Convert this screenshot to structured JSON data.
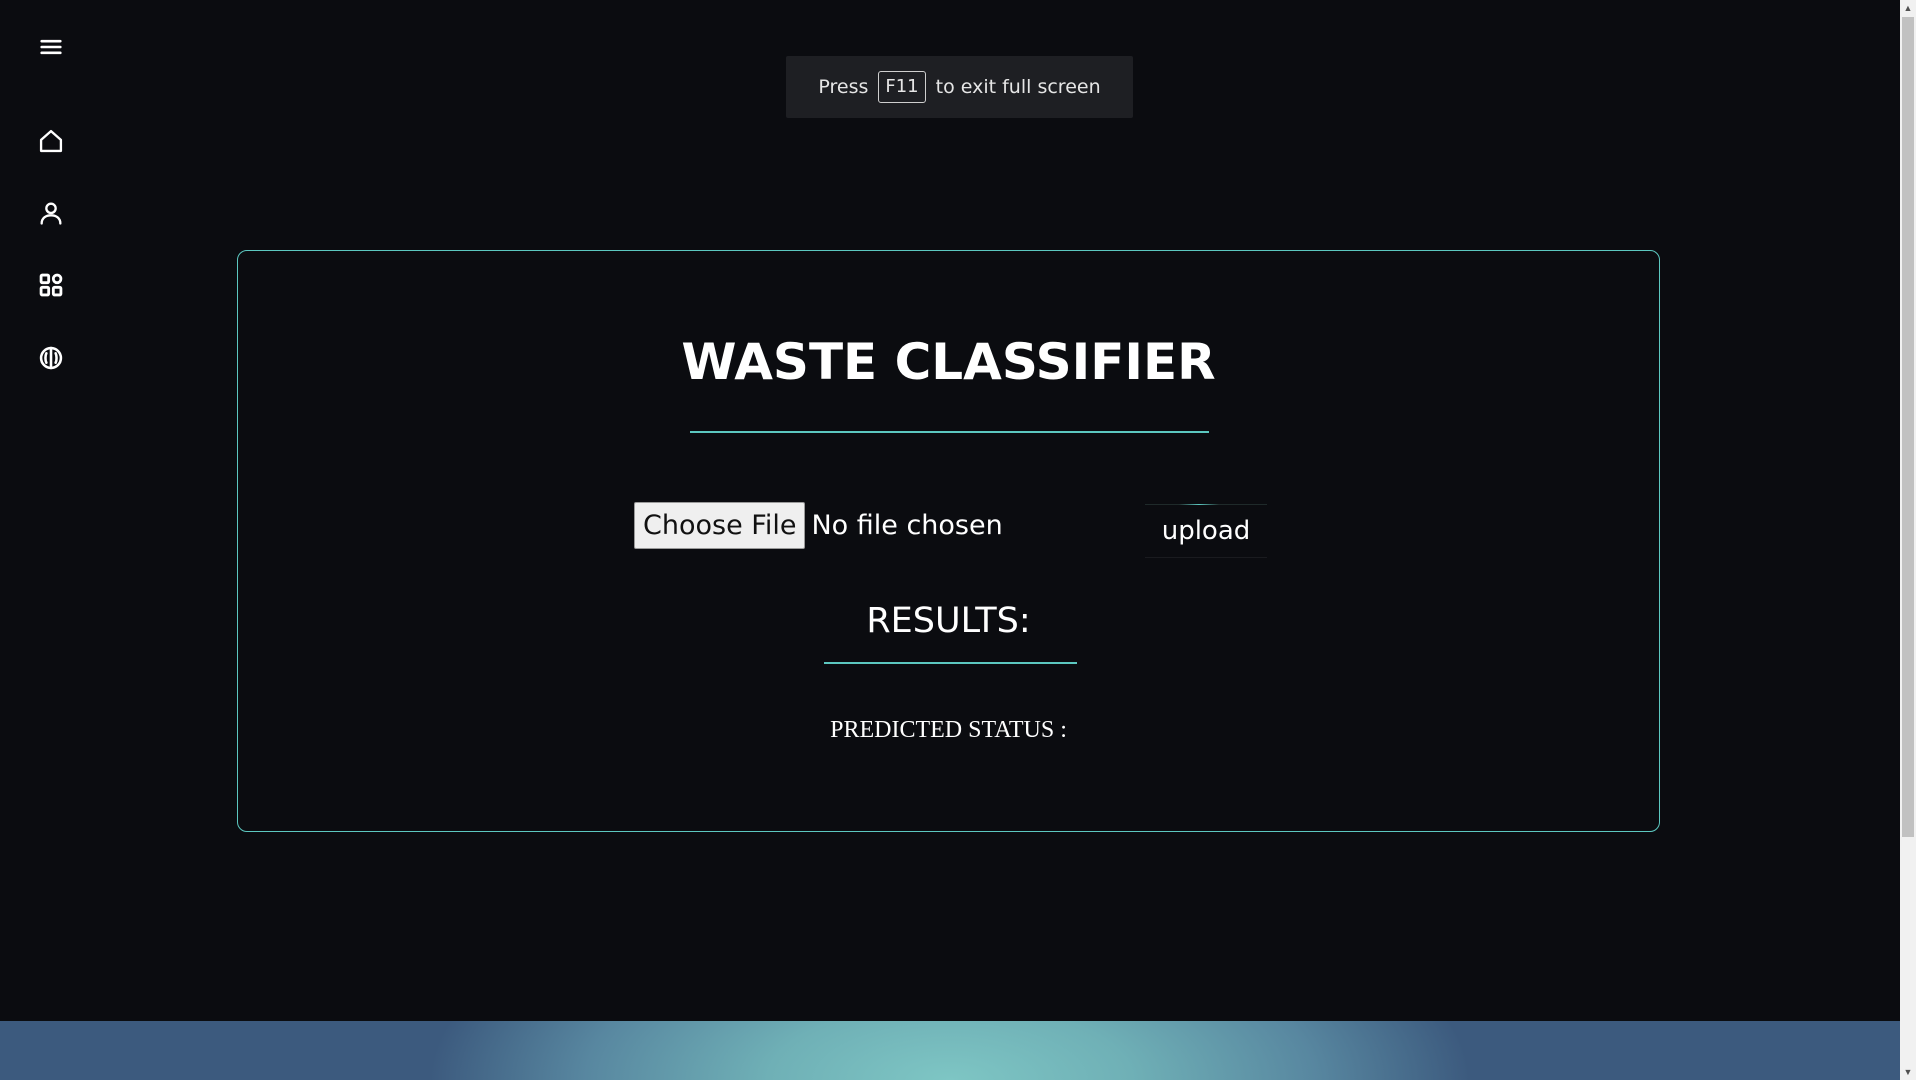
{
  "sidebar": {
    "icons": [
      "menu-icon",
      "home-icon",
      "user-icon",
      "apps-icon",
      "brain-icon"
    ]
  },
  "fullscreen_notice": {
    "prefix": "Press",
    "key": "F11",
    "suffix": "to exit full screen"
  },
  "card": {
    "title": "WASTE CLASSIFIER",
    "file_input": {
      "button_label": "Choose File",
      "status": "No file chosen"
    },
    "upload_label": "upload",
    "results_heading": "RESULTS:",
    "predicted_status_label": "PREDICTED STATUS :"
  },
  "colors": {
    "background": "#0b0c10",
    "accent": "#5cc8c0",
    "text": "#ffffff"
  }
}
